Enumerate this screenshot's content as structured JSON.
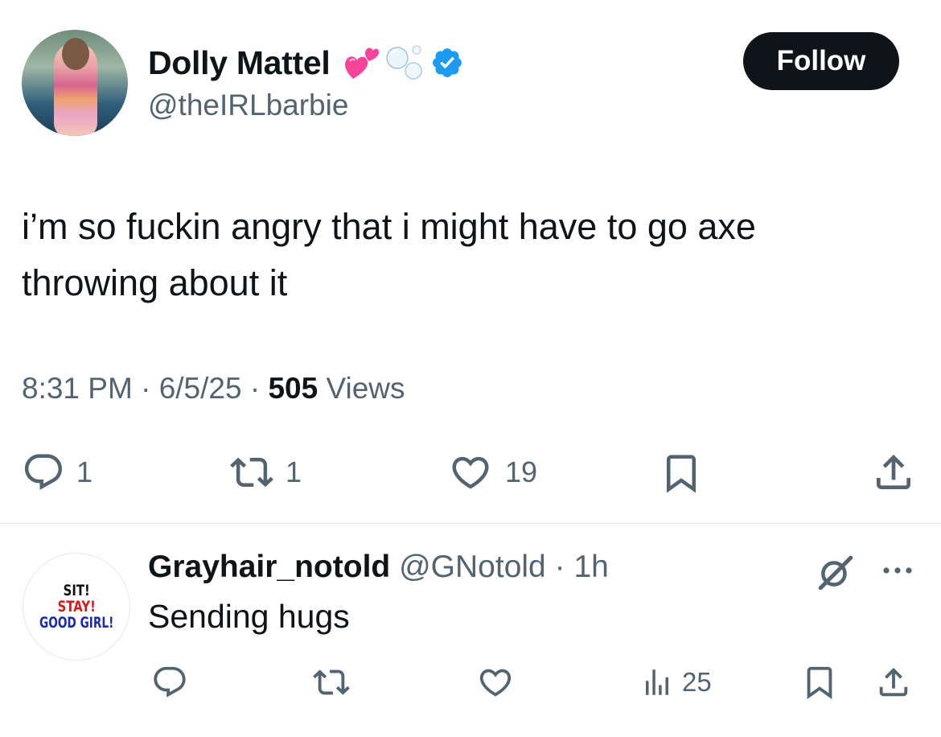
{
  "tweet": {
    "author_name": "Dolly Mattel",
    "author_handle": "@theIRLbarbie",
    "follow_label": "Follow",
    "text_line1": "i’m so fuckin angry that i might have to go axe",
    "text_line2": "throwing about it",
    "time": "8:31 PM",
    "date": "6/5/25",
    "separator": "·",
    "views_count": "505",
    "views_label": "Views",
    "reply_count": "1",
    "retweet_count": "1",
    "like_count": "19",
    "icons": {
      "reply": "reply-icon",
      "retweet": "retweet-icon",
      "like": "heart-icon",
      "bookmark": "bookmark-icon",
      "share": "share-icon",
      "verified": "verified-badge-icon",
      "emoji_1": "two-hearts-emoji",
      "emoji_2": "bubbles-emoji"
    }
  },
  "reply": {
    "author_name": "Grayhair_notold",
    "author_handle": "@GNotold",
    "separator": "·",
    "time_ago": "1h",
    "text": "Sending hugs",
    "views_count": "25",
    "avatar_text": {
      "line1": "SIT!",
      "line2": "STAY!",
      "line3": "GOOD GIRL!"
    },
    "icons": {
      "grok": "grok-icon",
      "more": "more-icon",
      "views": "analytics-icon"
    }
  },
  "colors": {
    "text_primary": "#0f1419",
    "text_secondary": "#536471",
    "verified_blue": "#1d9bf0",
    "follow_button": "#0f1419",
    "divider": "#e4e8eb",
    "heart_pink": "#f7449a"
  }
}
